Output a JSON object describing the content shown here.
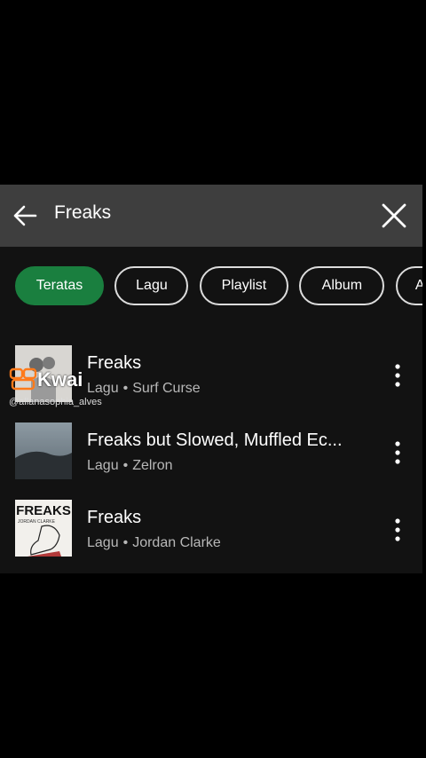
{
  "search": {
    "query": "Freaks"
  },
  "filters": [
    {
      "label": "Teratas",
      "active": true
    },
    {
      "label": "Lagu",
      "active": false
    },
    {
      "label": "Playlist",
      "active": false
    },
    {
      "label": "Album",
      "active": false
    },
    {
      "label": "Ar",
      "active": false
    }
  ],
  "results": [
    {
      "title": "Freaks",
      "type": "Lagu",
      "artist": "Surf Curse"
    },
    {
      "title": "Freaks but Slowed, Muffled Ec...",
      "type": "Lagu",
      "artist": "Zelron"
    },
    {
      "title": "Freaks",
      "type": "Lagu",
      "artist": "Jordan Clarke"
    }
  ],
  "cover_text": {
    "title": "FREAKS",
    "artist": "JORDAN CLARKE"
  },
  "watermark": {
    "brand": "Kwai",
    "username": "@allanasophia_alves"
  },
  "colors": {
    "active_chip": "#1a7f3f",
    "search_bar": "#3e3e3e",
    "background": "#121212"
  }
}
